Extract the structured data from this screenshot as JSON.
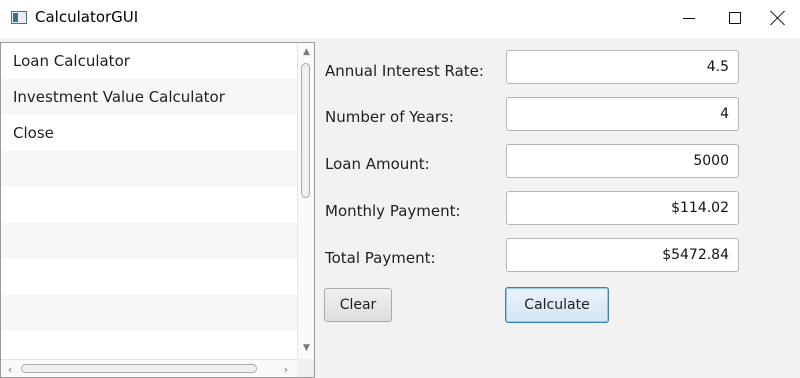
{
  "window": {
    "title": "CalculatorGUI"
  },
  "sidebar": {
    "items": [
      {
        "label": "Loan Calculator"
      },
      {
        "label": "Investment Value Calculator"
      },
      {
        "label": "Close"
      }
    ]
  },
  "form": {
    "annual_interest_rate": {
      "label": "Annual Interest Rate:",
      "value": "4.5"
    },
    "number_of_years": {
      "label": "Number of Years:",
      "value": "4"
    },
    "loan_amount": {
      "label": "Loan Amount:",
      "value": "5000"
    },
    "monthly_payment": {
      "label": "Monthly Payment:",
      "value": "$114.02"
    },
    "total_payment": {
      "label": "Total Payment:",
      "value": "$5472.84"
    }
  },
  "buttons": {
    "clear": "Clear",
    "calculate": "Calculate"
  },
  "colors": {
    "accent": "#3c7fb1",
    "panel_background": "#f2f2f2"
  }
}
